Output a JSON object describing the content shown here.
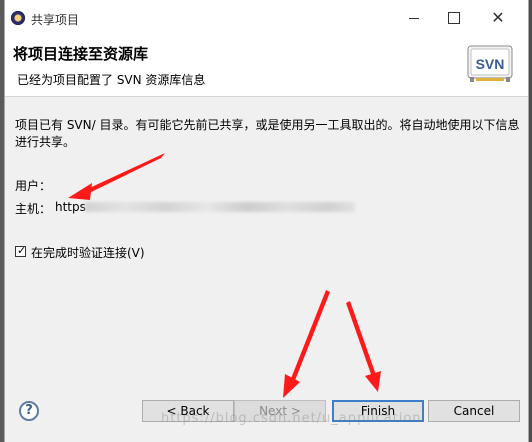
{
  "window": {
    "title": "共享项目",
    "minimize_label": "minimize",
    "maximize_label": "maximize",
    "close_label": "close"
  },
  "banner": {
    "title": "将项目连接至资源库",
    "description": "已经为项目配置了 SVN 资源库信息",
    "logo_text": "SVN"
  },
  "content": {
    "paragraph": "项目已有 SVN/ 目录。有可能它先前已共享，或是使用另一工具取出的。将自动地使用以下信息进行共享。",
    "user_label": "用户：",
    "host_label": "主机：",
    "host_value": "https"
  },
  "checkbox": {
    "label": "在完成时验证连接(V)",
    "checked": true
  },
  "buttons": {
    "help": "?",
    "back": "< Back",
    "next": "Next >",
    "finish": "Finish",
    "cancel": "Cancel"
  },
  "watermark": "https://blog.csdn.net/u_application",
  "colors": {
    "arrow": "#ff1a1a",
    "finish_border": "#3c7fc8",
    "banner_bg": "#ffffff",
    "dialog_bg": "#f0f0f0"
  }
}
